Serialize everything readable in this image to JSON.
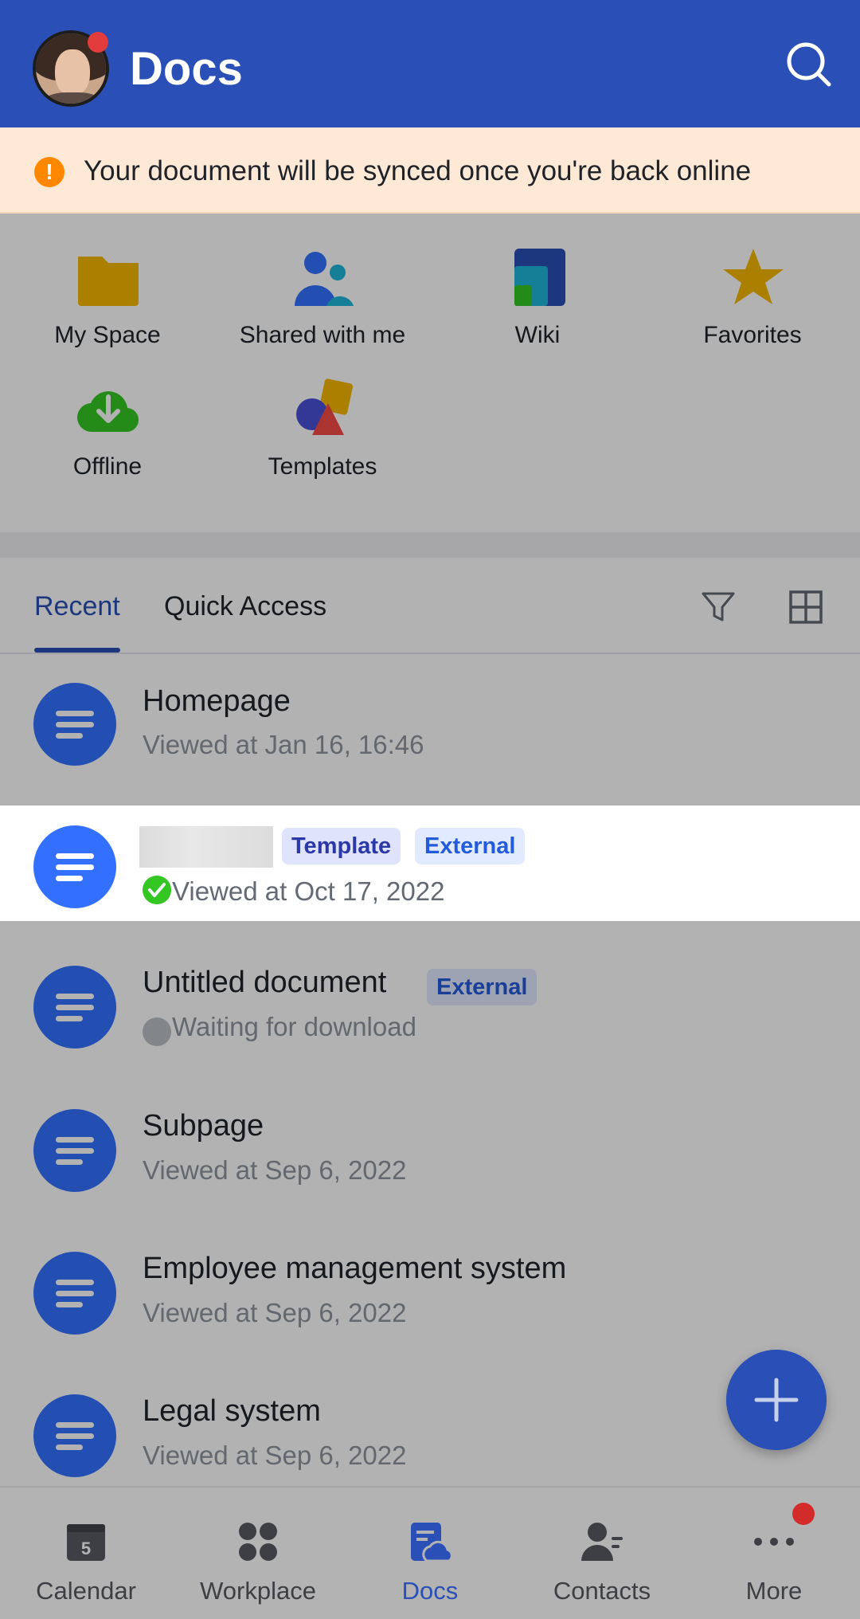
{
  "header": {
    "title": "Docs",
    "avatar_icon": "user-avatar",
    "search_icon": "search-icon",
    "brand_color": "#2a4fb6"
  },
  "banner": {
    "text": "Your document will be synced once you're back online",
    "icon": "warning-icon",
    "icon_glyph": "!"
  },
  "quick_access": [
    {
      "label": "My Space",
      "icon": "folder-icon"
    },
    {
      "label": "Shared with me",
      "icon": "shared-users-icon"
    },
    {
      "label": "Wiki",
      "icon": "wiki-icon"
    },
    {
      "label": "Favorites",
      "icon": "star-icon"
    },
    {
      "label": "Offline",
      "icon": "cloud-download-icon"
    },
    {
      "label": "Templates",
      "icon": "templates-icon"
    }
  ],
  "tabs": {
    "recent": "Recent",
    "quick_access": "Quick Access",
    "active": "Recent"
  },
  "documents": [
    {
      "title": "Homepage",
      "subtitle": "Viewed at  Jan 16, 16:46"
    },
    {
      "title": "",
      "subtitle": "Viewed at Oct 17, 2022",
      "badges": [
        "Template",
        "External"
      ],
      "status": "synced"
    },
    {
      "title": "Untitled document",
      "subtitle": "Waiting for download",
      "badges": [
        "External"
      ],
      "status": "pending"
    },
    {
      "title": "Subpage",
      "subtitle": "Viewed at Sep 6, 2022"
    },
    {
      "title": "Employee management system",
      "subtitle": "Viewed at Sep 6, 2022"
    },
    {
      "title": "Legal system",
      "subtitle": "Viewed at Sep 6, 2022"
    }
  ],
  "bottom_nav": [
    {
      "label": "Calendar",
      "icon": "calendar-icon",
      "calendar_day": "5"
    },
    {
      "label": "Workplace",
      "icon": "workplace-icon"
    },
    {
      "label": "Docs",
      "icon": "docs-icon",
      "active": true
    },
    {
      "label": "Contacts",
      "icon": "contacts-icon"
    },
    {
      "label": "More",
      "icon": "more-icon",
      "has_notification": true
    }
  ]
}
